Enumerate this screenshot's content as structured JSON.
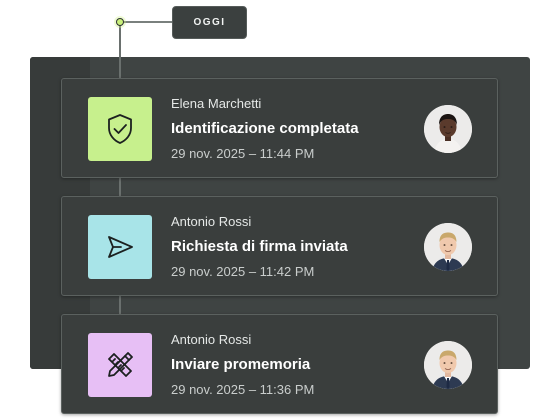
{
  "timeline": {
    "date_label": "OGGI",
    "dot_color": "#c9f07a"
  },
  "events": [
    {
      "user": "Elena Marchetti",
      "title": "Identificazione completata",
      "time": "29 nov. 2025 – 11:44 PM",
      "icon": "shield-check-icon",
      "icon_bg": "#c7f08d",
      "avatar": "avatar-elena-marchetti"
    },
    {
      "user": "Antonio Rossi",
      "title": "Richiesta di firma inviata",
      "time": "29 nov. 2025 – 11:42 PM",
      "icon": "send-icon",
      "icon_bg": "#a8e4e8",
      "avatar": "avatar-antonio-rossi"
    },
    {
      "user": "Antonio Rossi",
      "title": "Inviare promemoria",
      "time": "29 nov. 2025 – 11:36 PM",
      "icon": "pencil-ruler-icon",
      "icon_bg": "#e7bff5",
      "avatar": "avatar-antonio-rossi"
    }
  ]
}
